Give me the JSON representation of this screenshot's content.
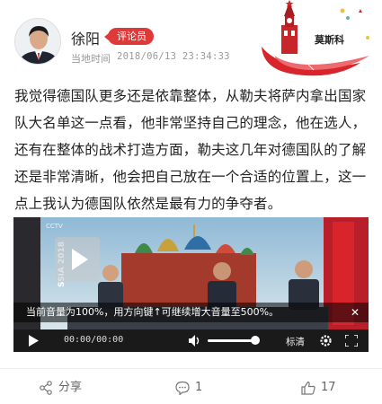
{
  "author": {
    "name": "徐阳",
    "badge": "评论员",
    "time_label": "当地时间",
    "time": "2018/06/13 23:34:33"
  },
  "location": {
    "label": "莫斯科"
  },
  "article": {
    "text": "我觉得德国队更多还是依靠整体，从勒夫将萨内拿出国家队大名单这一点看，他非常坚持自己的理念，他在选人，还有在整体的战术打造方面，勒夫这几年对德国队的了解还是非常清晰，他会把自己放在一个合适的位置上，这一点上我认为德国队依然是最有力的争夺者。"
  },
  "video": {
    "volume_tip": "当前音量为100%，用方向键↑可继续增大音量至500%。",
    "time": "00:00/00:00",
    "quality": "标清",
    "volume_percent": 100,
    "banner_text": "SSIA 2018",
    "channel_logo": "CCTV",
    "icons": [
      "play-icon",
      "close-icon",
      "volume-icon",
      "settings-icon",
      "fullscreen-icon"
    ]
  },
  "footer": {
    "share_label": "分享",
    "comment_count": "1",
    "like_count": "17",
    "icons": [
      "share-icon",
      "comment-icon",
      "like-icon"
    ]
  },
  "colors": {
    "badge": "#e0393a",
    "player_bg": "#000000",
    "text": "#222222",
    "muted": "#999999"
  }
}
